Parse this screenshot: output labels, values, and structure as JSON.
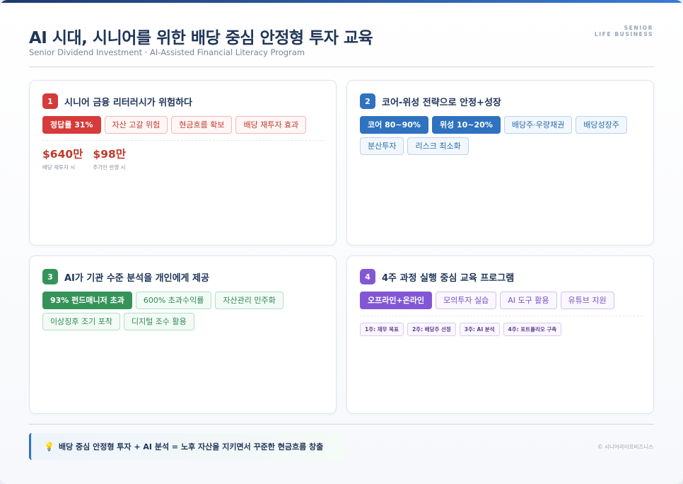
{
  "header": {
    "title": "AI 시대, 시니어를 위한 배당 중심 안정형 투자 교육",
    "subtitle": "Senior Dividend Investment · AI-Assisted Financial Literacy Program",
    "brand_line1": "SENIOR",
    "brand_line2": "LIFE BUSINESS"
  },
  "cards": [
    {
      "number": "1",
      "title": "시니어 금융 리터러시가 위험하다",
      "accent": "#d63a3a",
      "tags": [
        "정답률 31%",
        "자산 고갈 위험",
        "현금흐름 확보",
        "배당 재투자 효과"
      ],
      "stats": [
        {
          "value": "$640만",
          "label": "배당 재투자 시"
        },
        {
          "value": "$98만",
          "label": "주가만 반영 시"
        }
      ]
    },
    {
      "number": "2",
      "title": "코어-위성 전략으로 안정+성장",
      "accent": "#2f72bf",
      "tags": [
        "코어 80~90%",
        "위성 10~20%",
        "배당주·우량채권",
        "배당성장주",
        "분산투자",
        "리스크 최소화"
      ]
    },
    {
      "number": "3",
      "title": "AI가 기관 수준 분석을 개인에게 제공",
      "accent": "#35935a",
      "tags": [
        "93% 펀드매니저 초과",
        "600% 초과수익률",
        "자산관리 민주화",
        "이상징후 조기 포착",
        "디지털 조수 활용"
      ]
    },
    {
      "number": "4",
      "title": "4주 과정 실행 중심 교육 프로그램",
      "accent": "#8257d6",
      "tags": [
        "오프라인+온라인",
        "모의투자 실습",
        "AI 도구 활용",
        "유튜브 지원"
      ],
      "weeks": [
        "1주: 재무 목표",
        "2주: 배당주 선정",
        "3주: AI 분석",
        "4주: 포트폴리오 구축"
      ]
    }
  ],
  "footer": {
    "callout_icon": "lightbulb-icon",
    "callout": "배당 중심 안정형 투자 + AI 분석 = 노후 자산을 지키면서 꾸준한 현금흐름 창출",
    "copyright": "© 시니어라이프비즈니스"
  }
}
